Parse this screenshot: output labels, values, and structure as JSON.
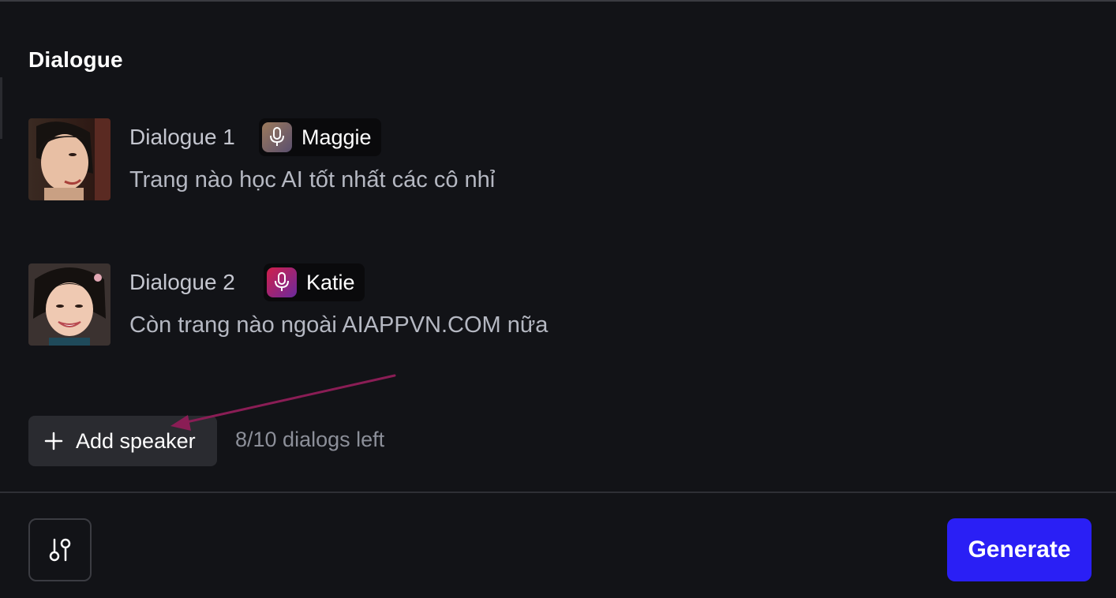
{
  "section": {
    "title": "Dialogue"
  },
  "dialogs": [
    {
      "label": "Dialogue 1",
      "voice": {
        "name": "Maggie",
        "icon": "microphone-icon",
        "gradient": [
          "#9c7a5c",
          "#5a4f6e"
        ]
      },
      "text": "Trang nào học AI tốt nhất các cô nhỉ"
    },
    {
      "label": "Dialogue 2",
      "voice": {
        "name": "Katie",
        "icon": "microphone-icon",
        "gradient": [
          "#d11f4a",
          "#6a2a9e"
        ]
      },
      "text": "Còn trang nào ngoài AIAPPVN.COM nữa"
    }
  ],
  "add_speaker": {
    "label": "Add speaker",
    "icon": "plus-icon"
  },
  "dialogs_left": "8/10 dialogs left",
  "footer": {
    "settings_icon": "adjustments-icon",
    "generate_label": "Generate"
  },
  "colors": {
    "background": "#121317",
    "accent": "#2a1ff5",
    "annotation_arrow": "#8a1d55"
  }
}
